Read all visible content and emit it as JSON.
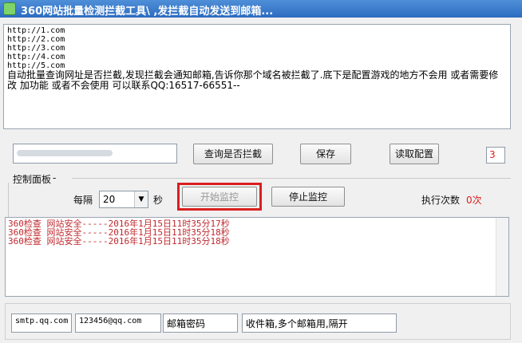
{
  "window": {
    "title": "360网站批量检测拦截工具\\ ,发拦截自动发送到邮箱..."
  },
  "urls": [
    "http://1.com",
    "http://2.com",
    "http://3.com",
    "http://4.com",
    "http://5.com"
  ],
  "description": "自动批量查询网址是否拦截,发现拦截会通知邮箱,告诉你那个域名被拦截了.底下是配置游戏的地方不会用 或者需要修改 加功能 或者不会使用 可以联系QQ:16517-66551--",
  "toolbar": {
    "query_button": "查询是否拦截",
    "save_button": "保存",
    "read_config_button": "读取配置",
    "count_value": "3"
  },
  "control_panel": {
    "label": "控制面板",
    "interval_label": "每隔",
    "interval_value": "20",
    "seconds_label": "秒",
    "start_button": "开始监控",
    "stop_button": "停止监控",
    "exec_count_label": "执行次数",
    "exec_count_value": "0次"
  },
  "log": [
    "360检查 网站安全-----2016年1月15日11时35分17秒",
    "360检查 网站安全-----2016年1月15日11时35分18秒",
    "360检查 网站安全-----2016年1月15日11时35分18秒"
  ],
  "mail": {
    "smtp": "smtp.qq.com",
    "account": "123456@qq.com",
    "password_placeholder": "邮箱密码",
    "recipients_placeholder": "收件箱,多个邮箱用,隔开"
  },
  "colors": {
    "log_text": "#c0282e",
    "highlight": "#d9201f",
    "count_text": "#d9201f"
  }
}
